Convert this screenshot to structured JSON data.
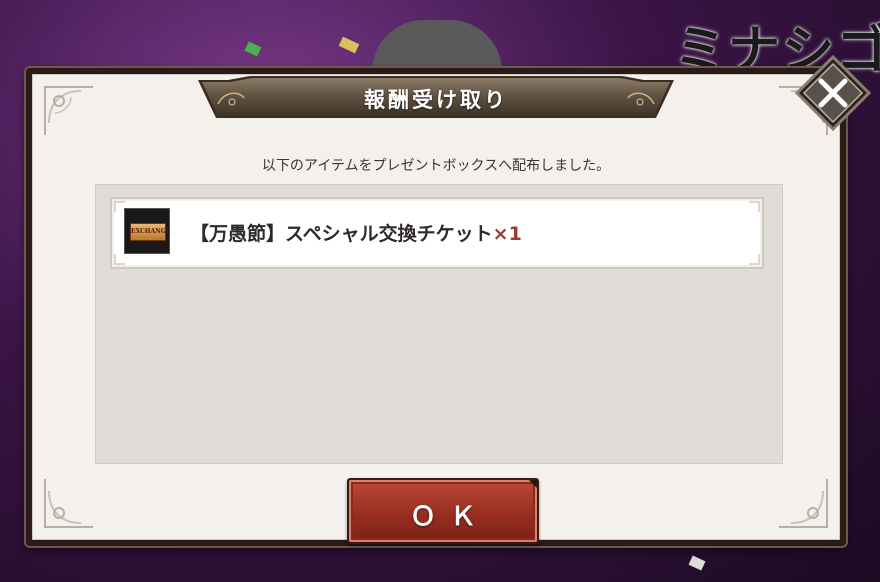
{
  "background": {
    "title_fragment": "ミナシゴ"
  },
  "dialog": {
    "title": "報酬受け取り",
    "message": "以下のアイテムをプレゼントボックスへ配布しました。",
    "items": [
      {
        "icon": "ticket-icon",
        "icon_text": "EXCHANGE",
        "name": "【万愚節】スペシャル交換チケット",
        "quantity": "×1"
      }
    ],
    "ok_label": "ＯＫ",
    "close_icon": "close-icon"
  },
  "colors": {
    "accent_red": "#9a2e20",
    "quantity": "#9c3a32",
    "panel": "#f4f1ec"
  }
}
